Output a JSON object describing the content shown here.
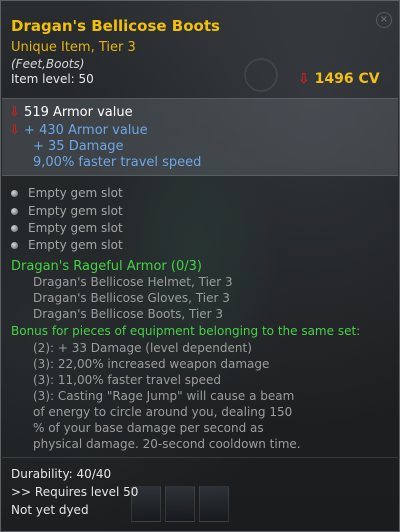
{
  "item": {
    "name": "Dragan's Bellicose Boots",
    "rarity": "Unique Item, Tier 3",
    "slot": "(Feet,Boots)",
    "item_level": "Item level: 50",
    "cv_arrow": "⇩",
    "cv": "1496 CV"
  },
  "stats": {
    "arrow": "⇩",
    "primary": "519  Armor value",
    "bonus_armor": "+ 430  Armor value",
    "bonus_damage": "+ 35  Damage",
    "travel_speed": "9,00% faster travel speed"
  },
  "gems": [
    "Empty  gem  slot",
    "Empty  gem  slot",
    "Empty  gem  slot",
    "Empty  gem  slot"
  ],
  "set": {
    "title": "Dragan's Rageful Armor (0/3)",
    "pieces": [
      "Dragan's Bellicose Helmet, Tier 3",
      "Dragan's Bellicose Gloves, Tier 3",
      "Dragan's Bellicose Boots, Tier 3"
    ],
    "bonus_header": "Bonus for pieces of equipment belonging to the same set:",
    "bonuses": [
      "(2): + 33 Damage (level dependent)",
      "(3): 22,00% increased weapon damage",
      "(3): 11,00% faster travel speed",
      "(3): Casting \"Rage Jump\" will cause a beam",
      "of energy to circle around you, dealing 150",
      "% of your base damage per second as",
      "physical damage. 20-second cooldown time."
    ]
  },
  "footer": {
    "durability": "Durability: 40/40",
    "requires": ">> Requires level 50",
    "dye": "Not yet dyed"
  },
  "close_symbol": "×",
  "colors": {
    "title": "#f1c10a",
    "stat_blue": "#6ea7e6",
    "set_green": "#45d245",
    "down_arrow": "#d21e1e"
  }
}
